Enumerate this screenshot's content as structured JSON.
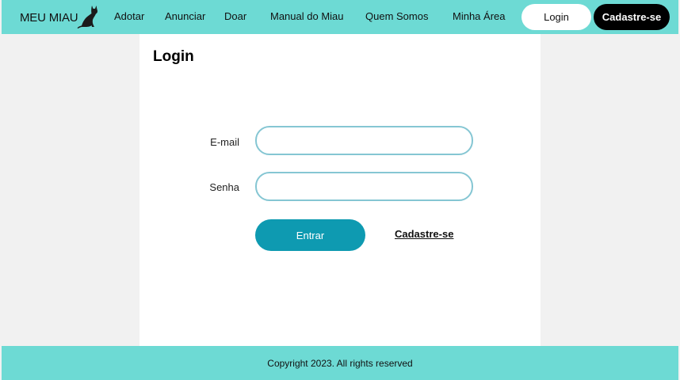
{
  "header": {
    "logo_text": "MEU MIAU",
    "logo_icon": "cat-icon",
    "nav": [
      {
        "label": "Adotar"
      },
      {
        "label": "Anunciar"
      },
      {
        "label": "Doar"
      },
      {
        "label": "Manual do Miau"
      },
      {
        "label": "Quem Somos"
      },
      {
        "label": "Minha Área"
      }
    ],
    "login_button": "Login",
    "signup_button": "Cadastre-se"
  },
  "main": {
    "title": "Login",
    "email_label": "E-mail",
    "email_value": "",
    "email_placeholder": "",
    "password_label": "Senha",
    "password_value": "",
    "password_placeholder": "",
    "submit_button": "Entrar",
    "signup_link": "Cadastre-se"
  },
  "footer": {
    "copyright": "Copyright 2023. All rights reserved"
  },
  "colors": {
    "accent": "#6ddad4",
    "primary_button": "#0e9ab1",
    "input_border": "#85c6d3",
    "background": "#f1f1f1"
  }
}
